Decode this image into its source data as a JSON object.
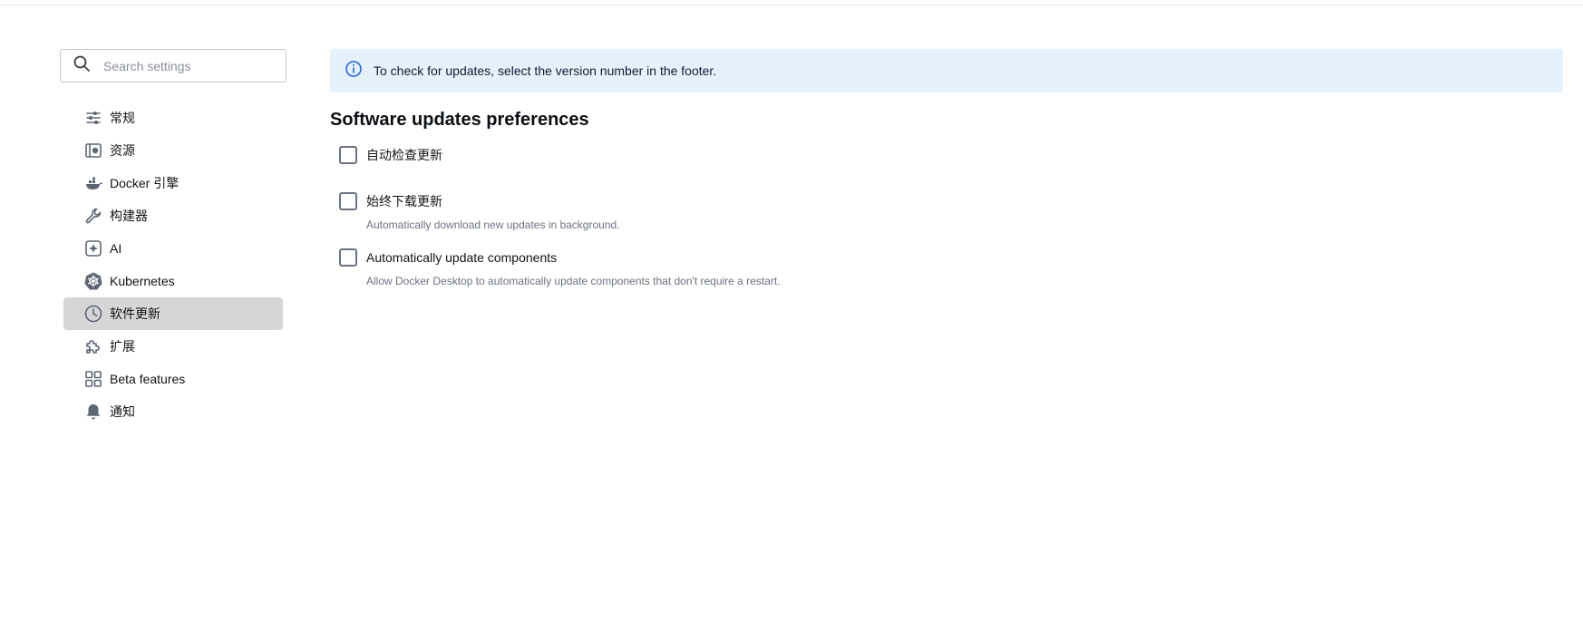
{
  "search": {
    "placeholder": "Search settings",
    "value": ""
  },
  "sidebar": {
    "items": [
      {
        "label": "常规",
        "icon": "sliders-icon",
        "active": false
      },
      {
        "label": "资源",
        "icon": "resources-icon",
        "active": false
      },
      {
        "label": "Docker 引擎",
        "icon": "docker-whale-icon",
        "active": false
      },
      {
        "label": "构建器",
        "icon": "wrench-icon",
        "active": false
      },
      {
        "label": "AI",
        "icon": "ai-diamond-icon",
        "active": false
      },
      {
        "label": "Kubernetes",
        "icon": "kubernetes-icon",
        "active": false
      },
      {
        "label": "软件更新",
        "icon": "clock-icon",
        "active": true
      },
      {
        "label": "扩展",
        "icon": "puzzle-icon",
        "active": false
      },
      {
        "label": "Beta features",
        "icon": "grid-icon",
        "active": false
      },
      {
        "label": "通知",
        "icon": "bell-icon",
        "active": false
      }
    ]
  },
  "banner": {
    "icon": "info-icon",
    "text": "To check for updates, select the version number in the footer."
  },
  "section": {
    "title": "Software updates preferences"
  },
  "options": [
    {
      "label": "自动检查更新",
      "description": "",
      "checked": false
    },
    {
      "label": "始终下载更新",
      "description": "Automatically download new updates in background.",
      "checked": false
    },
    {
      "label": "Automatically update components",
      "description": "Allow Docker Desktop to automatically update components that don't require a restart.",
      "checked": false
    }
  ],
  "colors": {
    "active_nav_bg": "#d6d6d6",
    "banner_bg": "#e5f1fb",
    "info_icon": "#1d63ed",
    "icon_gray": "#5f6672"
  }
}
